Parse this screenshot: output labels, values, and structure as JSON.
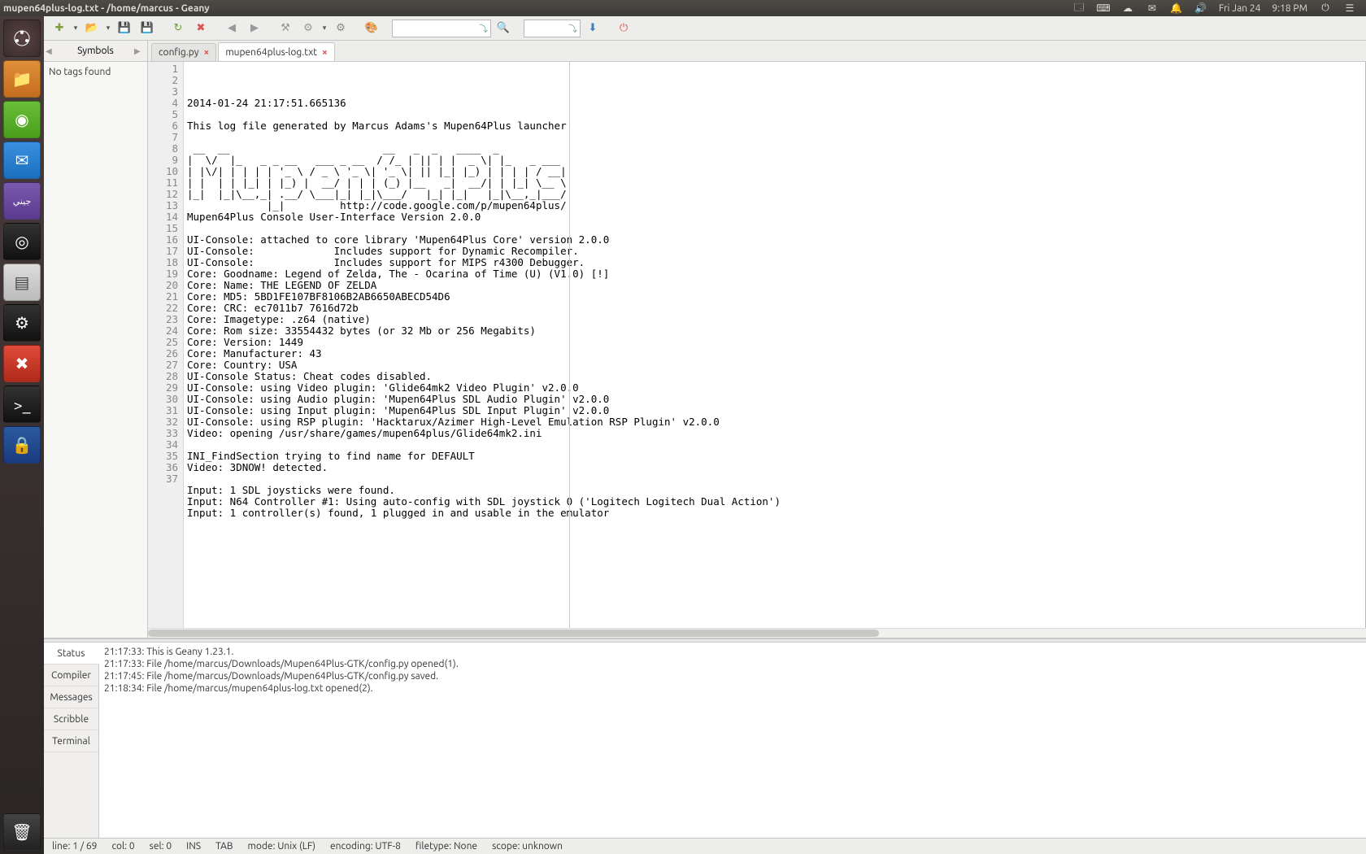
{
  "window": {
    "title": "mupen64plus-log.txt - /home/marcus - Geany"
  },
  "menubar": {
    "date": "Fri Jan 24",
    "time": "9:18 PM"
  },
  "launcher": {
    "items": [
      {
        "name": "dash",
        "glyph": "◌"
      },
      {
        "name": "files",
        "glyph": "🗂"
      },
      {
        "name": "chrome",
        "glyph": "◉"
      },
      {
        "name": "mail",
        "glyph": "✉"
      },
      {
        "name": "purple",
        "glyph": "جيني"
      },
      {
        "name": "disks",
        "glyph": "◎"
      },
      {
        "name": "textedit",
        "glyph": "▤"
      },
      {
        "name": "steam",
        "glyph": "⚙"
      },
      {
        "name": "shutdown",
        "glyph": "✖"
      },
      {
        "name": "terminal",
        "glyph": ">_"
      },
      {
        "name": "keyring",
        "glyph": "🔒"
      }
    ]
  },
  "sidebar": {
    "tab_label": "Symbols",
    "body_text": "No tags found"
  },
  "tabs": [
    {
      "label": "config.py",
      "active": false
    },
    {
      "label": "mupen64plus-log.txt",
      "active": true
    }
  ],
  "code_lines": [
    "2014-01-24 21:17:51.665136",
    "",
    "This log file generated by Marcus Adams's Mupen64Plus launcher",
    "",
    " __  __                         __   _  _   ____  _             ",
    "|  \\/  |_   _ _ __   ___ _ __  / /_ | || | |  _ \\| |_   _ ___   ",
    "| |\\/| | | | | '_ \\ / _ \\ '_ \\| '_ \\| || |_| |_) | | | | / __|  ",
    "| |  | | |_| | |_) |  __/ | | | (_) |__   _|  __/| | |_| \\__ \\  ",
    "|_|  |_|\\__,_| .__/ \\___|_| |_|\\___/   |_| |_|   |_|\\__,_|___/  ",
    "             |_|         http://code.google.com/p/mupen64plus/  ",
    "Mupen64Plus Console User-Interface Version 2.0.0",
    "",
    "UI-Console: attached to core library 'Mupen64Plus Core' version 2.0.0",
    "UI-Console:             Includes support for Dynamic Recompiler.",
    "UI-Console:             Includes support for MIPS r4300 Debugger.",
    "Core: Goodname: Legend of Zelda, The - Ocarina of Time (U) (V1.0) [!]",
    "Core: Name: THE LEGEND OF ZELDA",
    "Core: MD5: 5BD1FE107BF8106B2AB6650ABECD54D6",
    "Core: CRC: ec7011b7 7616d72b",
    "Core: Imagetype: .z64 (native)",
    "Core: Rom size: 33554432 bytes (or 32 Mb or 256 Megabits)",
    "Core: Version: 1449",
    "Core: Manufacturer: 43",
    "Core: Country: USA",
    "UI-Console Status: Cheat codes disabled.",
    "UI-Console: using Video plugin: 'Glide64mk2 Video Plugin' v2.0.0",
    "UI-Console: using Audio plugin: 'Mupen64Plus SDL Audio Plugin' v2.0.0",
    "UI-Console: using Input plugin: 'Mupen64Plus SDL Input Plugin' v2.0.0",
    "UI-Console: using RSP plugin: 'Hacktarux/Azimer High-Level Emulation RSP Plugin' v2.0.0",
    "Video: opening /usr/share/games/mupen64plus/Glide64mk2.ini",
    "",
    "INI_FindSection trying to find name for DEFAULT",
    "Video: 3DNOW! detected.",
    "",
    "Input: 1 SDL joysticks were found.",
    "Input: N64 Controller #1: Using auto-config with SDL joystick 0 ('Logitech Logitech Dual Action')",
    "Input: 1 controller(s) found, 1 plugged in and usable in the emulator"
  ],
  "messages": {
    "tabs": [
      "Status",
      "Compiler",
      "Messages",
      "Scribble",
      "Terminal"
    ],
    "active": "Status",
    "lines": [
      "21:17:33: This is Geany 1.23.1.",
      "21:17:33: File /home/marcus/Downloads/Mupen64Plus-GTK/config.py opened(1).",
      "21:17:45: File /home/marcus/Downloads/Mupen64Plus-GTK/config.py saved.",
      "21:18:34: File /home/marcus/mupen64plus-log.txt opened(2)."
    ]
  },
  "status": {
    "line": "line: 1 / 69",
    "col": "col: 0",
    "sel": "sel: 0",
    "ins": "INS",
    "tab": "TAB",
    "mode": "mode: Unix (LF)",
    "encoding": "encoding: UTF-8",
    "filetype": "filetype: None",
    "scope": "scope: unknown"
  }
}
